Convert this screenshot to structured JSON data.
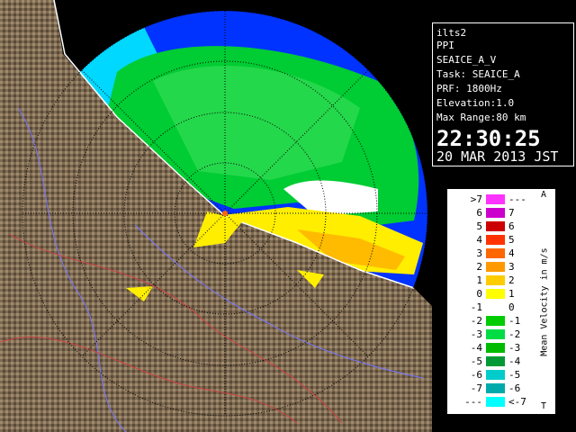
{
  "info": {
    "radar_name": "ilts2",
    "scan_mode": "PPI",
    "product": "SEAICE_A_V",
    "task": "Task: SEAICE_A",
    "prf": "PRF: 1800Hz",
    "elevation": "Elevation:1.0",
    "max_range": "Max Range:80 km",
    "time": "22:30:25",
    "date": "20 MAR 2013 JST"
  },
  "legend": {
    "title": "Mean Velocity in m/s",
    "top_marker": "A",
    "bottom_marker": "T",
    "rows": [
      {
        "left": ">7",
        "right": "---",
        "color": "#ff33ff"
      },
      {
        "left": "6",
        "right": "7",
        "color": "#cc00cc"
      },
      {
        "left": "5",
        "right": "6",
        "color": "#cc0000"
      },
      {
        "left": "4",
        "right": "5",
        "color": "#ff3300"
      },
      {
        "left": "3",
        "right": "4",
        "color": "#ff6600"
      },
      {
        "left": "2",
        "right": "3",
        "color": "#ff9900"
      },
      {
        "left": "1",
        "right": "2",
        "color": "#ffcc00"
      },
      {
        "left": "0",
        "right": "1",
        "color": "#ffff00"
      },
      {
        "left": "-1",
        "right": "0",
        "color": "#ffffff"
      },
      {
        "left": "-2",
        "right": "-1",
        "color": "#00cc00"
      },
      {
        "left": "-3",
        "right": "-2",
        "color": "#00dd44"
      },
      {
        "left": "-4",
        "right": "-3",
        "color": "#00bb00"
      },
      {
        "left": "-5",
        "right": "-4",
        "color": "#009933"
      },
      {
        "left": "-6",
        "right": "-5",
        "color": "#00cccc"
      },
      {
        "left": "-7",
        "right": "-6",
        "color": "#00aaaa"
      },
      {
        "left": "---",
        "right": "<-7",
        "color": "#00ffff"
      }
    ]
  },
  "colors": {
    "sea_outer": "#0033ff",
    "sea_inner": "#00ccff",
    "velocity_green": "#00cc33",
    "velocity_yellow": "#ffee00",
    "land": "#8a7458"
  }
}
